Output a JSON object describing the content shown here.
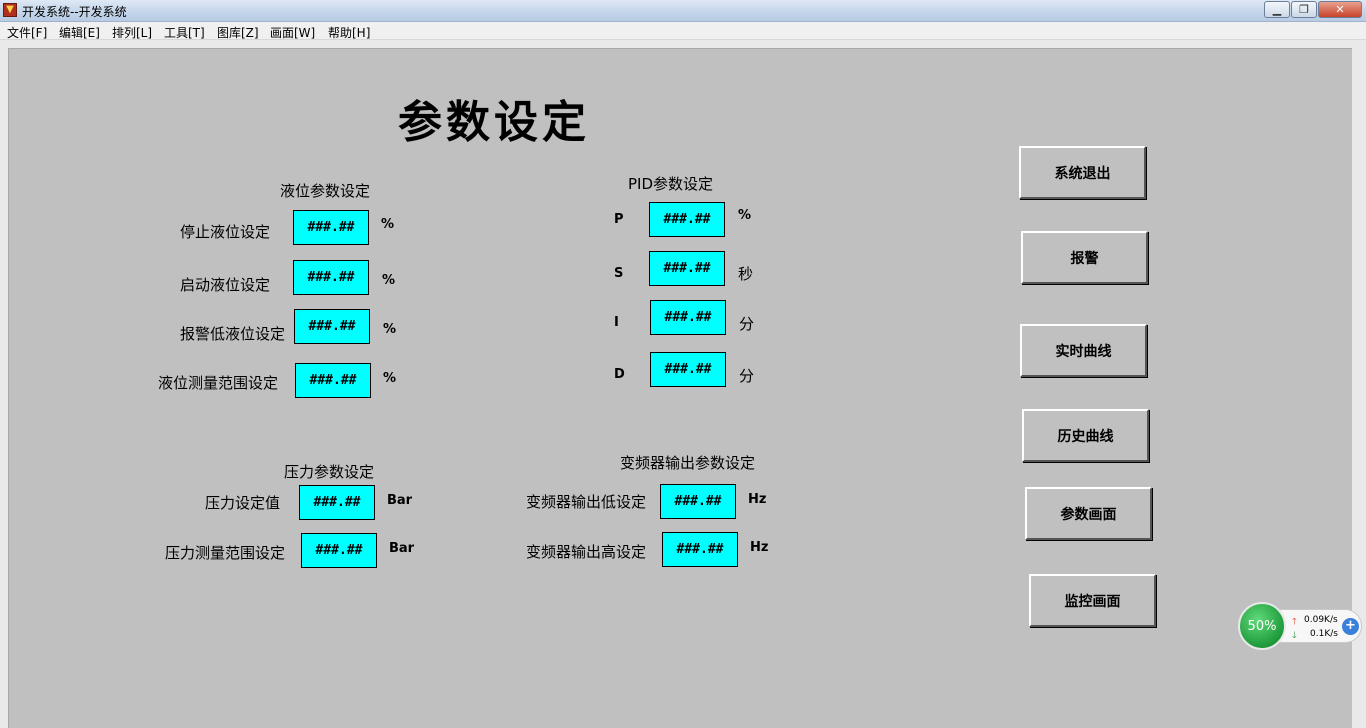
{
  "window": {
    "title": "开发系统--开发系统",
    "icon": "app-icon"
  },
  "menu": [
    "文件[F]",
    "编辑[E]",
    "排列[L]",
    "工具[T]",
    "图库[Z]",
    "画面[W]",
    "帮助[H]"
  ],
  "page_title": "参数设定",
  "level_section": {
    "title": "液位参数设定",
    "rows": [
      {
        "label": "停止液位设定",
        "value": "###.##",
        "unit": "%"
      },
      {
        "label": "启动液位设定",
        "value": "###.##",
        "unit": "%"
      },
      {
        "label": "报警低液位设定",
        "value": "###.##",
        "unit": "%"
      },
      {
        "label": "液位测量范围设定",
        "value": "###.##",
        "unit": "%"
      }
    ]
  },
  "pid_section": {
    "title": "PID参数设定",
    "rows": [
      {
        "label": "P",
        "value": "###.##",
        "unit": "%"
      },
      {
        "label": "S",
        "value": "###.##",
        "unit": "秒"
      },
      {
        "label": "I",
        "value": "###.##",
        "unit": "分"
      },
      {
        "label": "D",
        "value": "###.##",
        "unit": "分"
      }
    ]
  },
  "pressure_section": {
    "title": "压力参数设定",
    "rows": [
      {
        "label": "压力设定值",
        "value": "###.##",
        "unit": "Bar"
      },
      {
        "label": "压力测量范围设定",
        "value": "###.##",
        "unit": "Bar"
      }
    ]
  },
  "vfd_section": {
    "title": "变频器输出参数设定",
    "rows": [
      {
        "label": "变频器输出低设定",
        "value": "###.##",
        "unit": "Hz"
      },
      {
        "label": "变频器输出高设定",
        "value": "###.##",
        "unit": "Hz"
      }
    ]
  },
  "nav_buttons": [
    "系统退出",
    "报警",
    "实时曲线",
    "历史曲线",
    "参数画面",
    "监控画面"
  ],
  "network_widget": {
    "percent": "50%",
    "upload": "0.09K/s",
    "download": "0.1K/s"
  },
  "colors": {
    "field_bg": "#00ffff",
    "panel_bg": "#c0c0c0"
  }
}
